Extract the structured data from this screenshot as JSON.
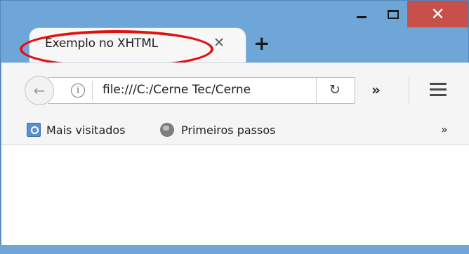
{
  "window": {
    "controls": {
      "minimize_icon": "minimize-icon",
      "maximize_icon": "maximize-icon",
      "close_glyph": "✕"
    }
  },
  "tab": {
    "title": "Exemplo no XHTML",
    "close_glyph": "✕",
    "annotation_color": "#e31010"
  },
  "new_tab": {
    "glyph": "+"
  },
  "toolbar": {
    "back_glyph": "←",
    "info_glyph": "i",
    "url": "file:///C:/Cerne Tec/Cerne",
    "reload_glyph": "↻",
    "overflow_glyph": "»"
  },
  "bookmarks": {
    "items": [
      {
        "label": "Mais visitados",
        "icon": "search-icon"
      },
      {
        "label": "Primeiros passos",
        "icon": "globe-icon"
      }
    ],
    "overflow_glyph": "»"
  },
  "colors": {
    "frame": "#6fa6d8",
    "close_button": "#c7504a",
    "toolbar": "#f5f5f5",
    "annotation": "#e31010"
  }
}
